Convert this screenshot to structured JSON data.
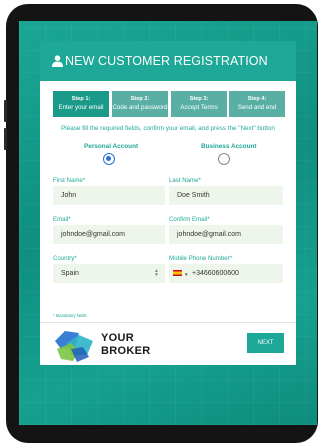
{
  "header": {
    "title": "NEW CUSTOMER REGISTRATION",
    "icon": "user-icon"
  },
  "steps": [
    {
      "num": "Step 1:",
      "label": "Enter your email",
      "active": true
    },
    {
      "num": "Step 2:",
      "label": "Code and password",
      "active": false
    },
    {
      "num": "Step 3:",
      "label": "Accept Terms",
      "active": false
    },
    {
      "num": "Step 4:",
      "label": "Send and end",
      "active": false
    }
  ],
  "instructions": "Please fill the required fields, confirm your email, and press the \"Next\" button",
  "account_types": {
    "personal": {
      "label": "Personal Account",
      "selected": true
    },
    "business": {
      "label": "Business Account",
      "selected": false
    }
  },
  "form": {
    "first_name": {
      "label": "First Name*",
      "value": "John"
    },
    "last_name": {
      "label": "Last Name*",
      "value": "Doe Smith"
    },
    "email": {
      "label": "Email*",
      "value": "johndoe@gmail.com"
    },
    "confirm_email": {
      "label": "Confirm Email*",
      "value": "johndoe@gmail.com"
    },
    "country": {
      "label": "Country*",
      "value": "Spain"
    },
    "phone": {
      "label": "Mobile Phone Number*",
      "value": "+34660600600",
      "flag": "spain-flag-icon"
    }
  },
  "mandatory_note": "* Mandatory fields",
  "footer": {
    "brand_line1": "YOUR",
    "brand_line2": "BROKER",
    "next_label": "NEXT"
  },
  "colors": {
    "accent": "#1ea897",
    "step_active": "#1a9a89",
    "step_inactive": "#5aafa4",
    "field_bg": "#eef6ec",
    "radio_selected": "#2a6fd8"
  }
}
